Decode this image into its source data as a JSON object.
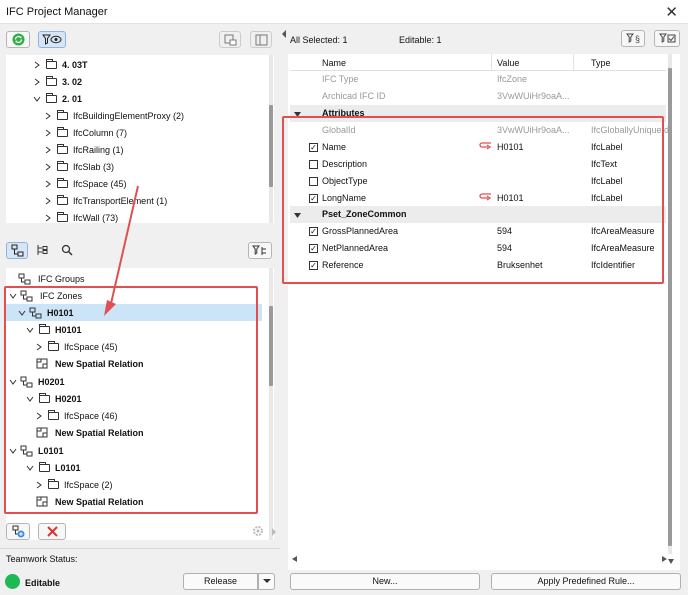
{
  "window": {
    "title": "IFC Project Manager",
    "close_glyph": "✕"
  },
  "top_tree": [
    {
      "label": "4. 03T",
      "bold": true,
      "expanded": false,
      "level": 0
    },
    {
      "label": "3. 02",
      "bold": true,
      "expanded": false,
      "level": 0
    },
    {
      "label": "2. 01",
      "bold": true,
      "expanded": true,
      "level": 0
    },
    {
      "label": "IfcBuildingElementProxy (2)",
      "level": 1
    },
    {
      "label": "IfcColumn (7)",
      "level": 1
    },
    {
      "label": "IfcRailing (1)",
      "level": 1
    },
    {
      "label": "IfcSlab (3)",
      "level": 1
    },
    {
      "label": "IfcSpace (45)",
      "level": 1
    },
    {
      "label": "IfcTransportElement (1)",
      "level": 1
    },
    {
      "label": "IfcWall (73)",
      "level": 1
    }
  ],
  "bottom_tree": {
    "groups_label": "IFC Groups",
    "zones_label": "IFC Zones",
    "zones": [
      {
        "name": "H0101",
        "folder": "H0101",
        "space": "IfcSpace (45)",
        "relation": "New Spatial Relation",
        "selected": true
      },
      {
        "name": "H0201",
        "folder": "H0201",
        "space": "IfcSpace (46)",
        "relation": "New Spatial Relation",
        "selected": false
      },
      {
        "name": "L0101",
        "folder": "L0101",
        "space": "IfcSpace (2)",
        "relation": "New Spatial Relation",
        "selected": false
      }
    ]
  },
  "teamwork": {
    "label": "Teamwork Status:",
    "status": "Editable",
    "status_color": "#1db954",
    "release_label": "Release"
  },
  "header": {
    "all_selected": "All Selected: 1",
    "editable": "Editable: 1"
  },
  "columns": {
    "name": "Name",
    "value": "Value",
    "type": "Type"
  },
  "info_rows": [
    {
      "name": "IFC Type",
      "value": "IfcZone",
      "type": ""
    },
    {
      "name": "Archicad IFC ID",
      "value": "3VwWUiHr9oaA...",
      "type": ""
    }
  ],
  "attributes_label": "Attributes",
  "attributes": [
    {
      "name": "GlobalId",
      "value": "3VwWUiHr9oaA...",
      "type": "IfcGloballyUniqueId",
      "checkbox": false,
      "disabled": true,
      "checked": false
    },
    {
      "name": "Name",
      "value": "H0101",
      "type": "IfcLabel",
      "checkbox": true,
      "checked": true,
      "link": true
    },
    {
      "name": "Description",
      "value": "",
      "type": "IfcText",
      "checkbox": true,
      "checked": false
    },
    {
      "name": "ObjectType",
      "value": "",
      "type": "IfcLabel",
      "checkbox": true,
      "checked": false
    },
    {
      "name": "LongName",
      "value": "H0101",
      "type": "IfcLabel",
      "checkbox": true,
      "checked": true,
      "link": true
    }
  ],
  "pset_label": "Pset_ZoneCommon",
  "pset": [
    {
      "name": "GrossPlannedArea",
      "value": "594",
      "type": "IfcAreaMeasure",
      "checked": true
    },
    {
      "name": "NetPlannedArea",
      "value": "594",
      "type": "IfcAreaMeasure",
      "checked": true
    },
    {
      "name": "Reference",
      "value": "Bruksenhet",
      "type": "IfcIdentifier",
      "checked": true
    }
  ],
  "buttons": {
    "new": "New...",
    "apply": "Apply Predefined Rule..."
  },
  "accent": {
    "annotation_red": "#e05050",
    "selection_blue": "#cce4f7"
  }
}
